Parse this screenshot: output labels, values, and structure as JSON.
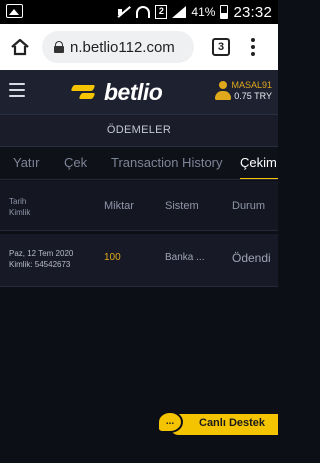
{
  "status_bar": {
    "battery_percent": "41%",
    "time": "23:32",
    "sim_number": "2"
  },
  "browser": {
    "url": "n.betlio112.com",
    "tab_count": "3"
  },
  "header": {
    "logo_text": "betlio",
    "username": "MASAL91",
    "balance": "0.75 TRY"
  },
  "page": {
    "title": "ÖDEMELER"
  },
  "tabs": [
    {
      "label": "Yatır"
    },
    {
      "label": "Çek"
    },
    {
      "label": "Transaction History"
    },
    {
      "label": "Çekim",
      "active": true
    }
  ],
  "table": {
    "headers": {
      "date": "Tarih",
      "id": "Kimlik",
      "amount": "Miktar",
      "system": "Sistem",
      "status": "Durum"
    },
    "rows": [
      {
        "date": "Paz, 12 Tem 2020",
        "id": "Kimlik: 54542673",
        "amount": "100",
        "system": "Banka ...",
        "status": "Ödendi"
      }
    ]
  },
  "live_support": {
    "label": "Canlı Destek",
    "bubble_text": "..."
  },
  "colors": {
    "accent": "#f5c400",
    "gold_text": "#e0a91c",
    "header_bg": "#1e2230",
    "page_bg": "#0d0f17"
  }
}
